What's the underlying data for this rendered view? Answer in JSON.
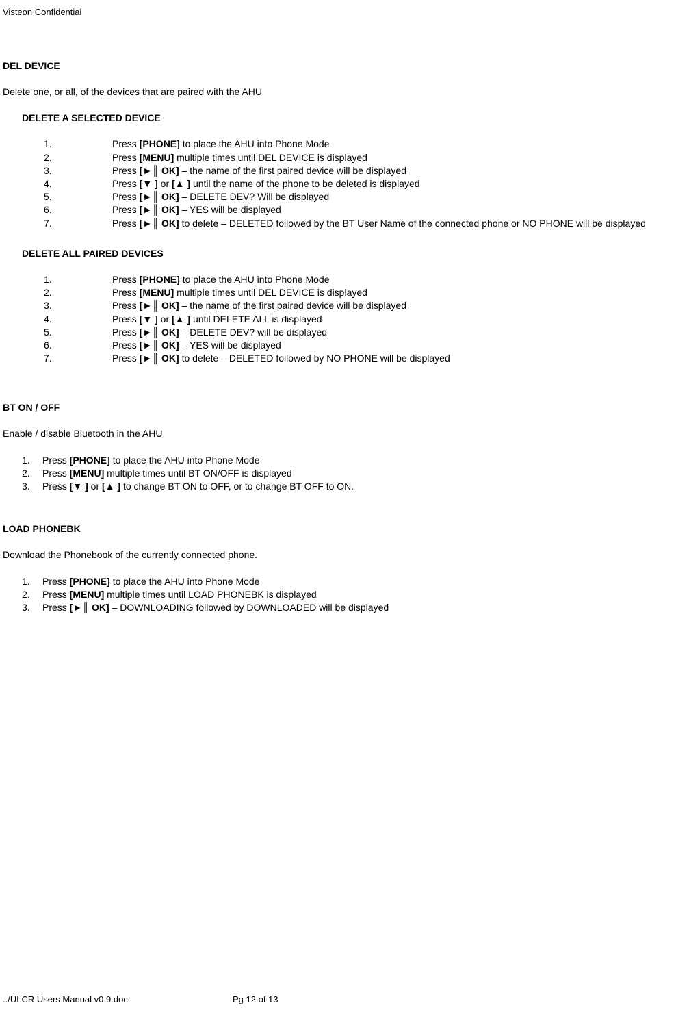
{
  "header": "Visteon Confidential",
  "sections": [
    {
      "title": "DEL DEVICE",
      "intro": "Delete one, or all, of the devices that are paired with the AHU",
      "subsections": [
        {
          "title": "DELETE A SELECTED DEVICE",
          "steps": [
            {
              "num": "1.",
              "parts": [
                "Press ",
                "[PHONE]",
                " to place the AHU into Phone Mode"
              ]
            },
            {
              "num": "2.",
              "parts": [
                "Press ",
                "[MENU]",
                " multiple times until DEL DEVICE is displayed"
              ]
            },
            {
              "num": "3.",
              "parts": [
                "Press ",
                "[►║ OK]",
                " – the name of the first paired device will be displayed"
              ]
            },
            {
              "num": "4.",
              "parts": [
                "Press ",
                "[▼ ]",
                " or ",
                "[▲ ]",
                " until the name of the phone to be deleted is displayed"
              ]
            },
            {
              "num": "5.",
              "parts": [
                "Press ",
                "[►║ OK]",
                " – DELETE DEV? Will be displayed"
              ]
            },
            {
              "num": "6.",
              "parts": [
                "Press ",
                "[►║ OK]",
                " – YES will be displayed"
              ]
            },
            {
              "num": "7.",
              "parts": [
                "Press ",
                "[►║ OK]",
                " to delete – DELETED followed by the BT User Name of the connected phone or NO PHONE will be displayed"
              ]
            }
          ]
        },
        {
          "title": "DELETE ALL PAIRED DEVICES",
          "steps": [
            {
              "num": "1.",
              "parts": [
                "Press ",
                "[PHONE]",
                " to place the AHU into Phone Mode"
              ]
            },
            {
              "num": "2.",
              "parts": [
                "Press ",
                "[MENU]",
                " multiple times until DEL DEVICE is displayed"
              ]
            },
            {
              "num": "3.",
              "parts": [
                "Press ",
                "[►║ OK]",
                " – the name of the first paired device will be displayed"
              ]
            },
            {
              "num": "4.",
              "parts": [
                "Press ",
                "[▼ ]",
                " or ",
                "[▲ ]",
                " until DELETE ALL is displayed"
              ]
            },
            {
              "num": "5.",
              "parts": [
                "Press ",
                "[►║ OK]",
                " – DELETE DEV? will be displayed"
              ]
            },
            {
              "num": "6.",
              "parts": [
                "Press ",
                "[►║ OK]",
                " – YES will be displayed"
              ]
            },
            {
              "num": "7.",
              "parts": [
                "Press ",
                "[►║ OK]",
                " to delete – DELETED followed by NO PHONE will be displayed"
              ]
            }
          ]
        }
      ]
    },
    {
      "title": "BT ON / OFF",
      "intro": "Enable / disable Bluetooth in the AHU",
      "steps": [
        {
          "num": "1.",
          "parts": [
            "Press ",
            "[PHONE]",
            " to place the AHU into Phone Mode"
          ]
        },
        {
          "num": "2.",
          "parts": [
            "Press ",
            "[MENU]",
            " multiple times until BT ON/OFF is displayed"
          ]
        },
        {
          "num": "3.",
          "parts": [
            "Press ",
            "[▼ ]",
            " or ",
            "[▲ ]",
            " to change BT ON to OFF, or to change BT OFF to ON."
          ]
        }
      ]
    },
    {
      "title": "LOAD PHONEBK",
      "intro": "Download the Phonebook of the currently connected phone.",
      "steps": [
        {
          "num": "1.",
          "parts": [
            "Press ",
            "[PHONE]",
            " to place the AHU into Phone Mode"
          ]
        },
        {
          "num": "2.",
          "parts": [
            "Press ",
            "[MENU]",
            " multiple times until LOAD PHONEBK is displayed"
          ]
        },
        {
          "num": "3.",
          "parts": [
            "Press ",
            "[►║ OK]",
            " – DOWNLOADING followed by DOWNLOADED will be displayed"
          ]
        }
      ]
    }
  ],
  "footer": {
    "left": "../ULCR Users Manual v0.9.doc",
    "right": "Pg 12 of 13"
  }
}
